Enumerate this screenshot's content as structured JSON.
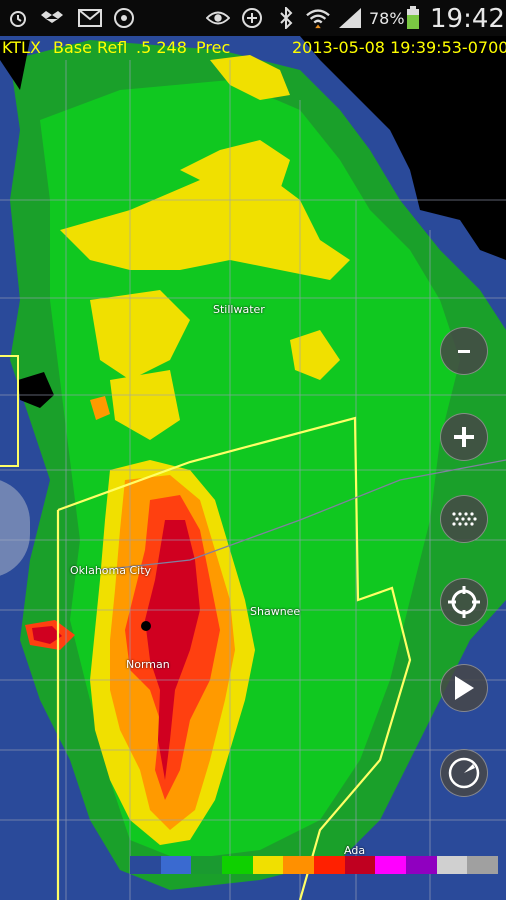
{
  "status_bar": {
    "battery": "78%",
    "time": "19:42",
    "icons": [
      "alarm-icon",
      "dropbox-icon",
      "gmail-icon",
      "app-icon",
      "eye-icon",
      "nfc-icon",
      "bluetooth-icon",
      "wifi-icon",
      "signal-icon",
      "battery-icon"
    ]
  },
  "header": {
    "station": "KTLX",
    "product": "Base Refl",
    "tilt": ".5 248",
    "mode": "Prec",
    "timestamp": "2013-05-08 19:39:53-0700"
  },
  "cities": [
    {
      "name": "Stillwater"
    },
    {
      "name": "Oklahoma City"
    },
    {
      "name": "Shawnee"
    },
    {
      "name": "Norman"
    },
    {
      "name": "Ada"
    }
  ],
  "controls": [
    {
      "name": "zoom-out-button",
      "symbol": "−"
    },
    {
      "name": "zoom-in-button",
      "symbol": "+"
    },
    {
      "name": "layers-button",
      "symbol": "⁙"
    },
    {
      "name": "locate-button",
      "symbol": "⊕"
    },
    {
      "name": "play-button",
      "symbol": "▶"
    },
    {
      "name": "compass-button",
      "symbol": "◐"
    }
  ],
  "legend_colors": [
    "#2a4a9a",
    "#3a6ad0",
    "#1a9a30",
    "#0fd000",
    "#f0e000",
    "#ff9000",
    "#ff2000",
    "#c00020",
    "#ff00ff",
    "#9000c0",
    "#d0d0d0",
    "#a0a0a0"
  ],
  "colors": {
    "header_text": "#ffff00",
    "county_lines": "#9aa0b8",
    "state_border": "#ffff66"
  }
}
